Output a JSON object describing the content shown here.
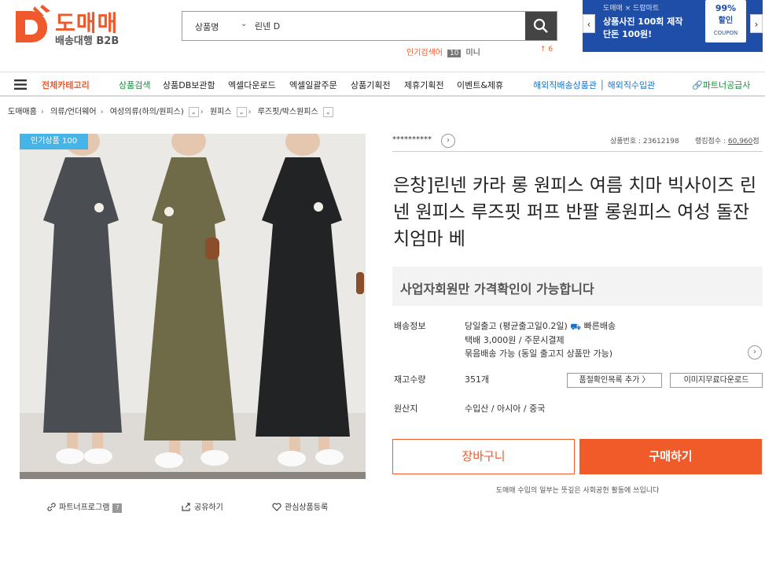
{
  "header": {
    "logo_title": "도매매",
    "logo_subtitle": "배송대행 B2B",
    "search": {
      "category": "상품명",
      "value": "린넨 D",
      "placeholder": ""
    },
    "popular": {
      "label": "인기검색어",
      "rank": "10",
      "word": "미니",
      "change": "↑ 6"
    },
    "banner": {
      "brand": "도매매 × 드랍마트",
      "line1": "상품사진 100회 제작",
      "line2": "단돈 100원!",
      "coupon_percent": "99%",
      "coupon_sale": "할인",
      "coupon_word": "COUPON"
    }
  },
  "nav": {
    "all_categories": "전체카테고리",
    "items": [
      "상품검색",
      "상품DB보관함",
      "엑셀다운로드",
      "엑셀일괄주문",
      "상품기획전",
      "제휴기획전",
      "이벤트&제휴"
    ],
    "overseas": "해외직배송상품관 │ 해외직수입관",
    "partner": "파트너공급사"
  },
  "breadcrumb": [
    "도매매홈",
    "의류/언더웨어",
    "여성의류(하의/원피스)",
    "원피스",
    "루즈핏/박스원피스"
  ],
  "product": {
    "popular_badge": "인기상품 100",
    "seller": "**********",
    "product_no": "상품번호 : 23612198",
    "ranking_label": "랭킹점수 : ",
    "ranking_value": "60,960",
    "ranking_unit": "점",
    "title": "은창]린넨 카라 롱 원피스 여름 치마 빅사이즈 린넨 원피스 루즈핏 퍼프 반팔 롱원피스 여성 돌잔치엄마 베",
    "notice": "사업자회원만 가격확인이 가능합니다",
    "shipping_label": "배송정보",
    "shipping_line1": "당일출고 (평균출고일0.2일)",
    "shipping_fast": "빠른배송",
    "shipping_line2": "택배 3,000원 / 주문시결제",
    "shipping_line3": "묶음배송 가능 (동일 출고지 상품만 가능)",
    "stock_label": "재고수량",
    "stock_value": "351개",
    "stock_btn1": "품절확인목록 추가 〉",
    "stock_btn2": "이미지무료다운로드",
    "origin_label": "원산지",
    "origin_value": "수입산 / 아시아 / 중국",
    "cart_button": "장바구니",
    "buy_button": "구매하기",
    "footnote": "도매매 수입의 일부는 뜻깊은 사회공헌 활동에 쓰입니다"
  },
  "share": {
    "partner_program": "파트너프로그램",
    "partner_q": "?",
    "share": "공유하기",
    "wishlist": "관심상품등록"
  },
  "colors": {
    "brand": "#ee5a2b",
    "badge": "#46b4e6",
    "nav_green": "#1a8c3c",
    "nav_blue": "#1a6fc7"
  }
}
